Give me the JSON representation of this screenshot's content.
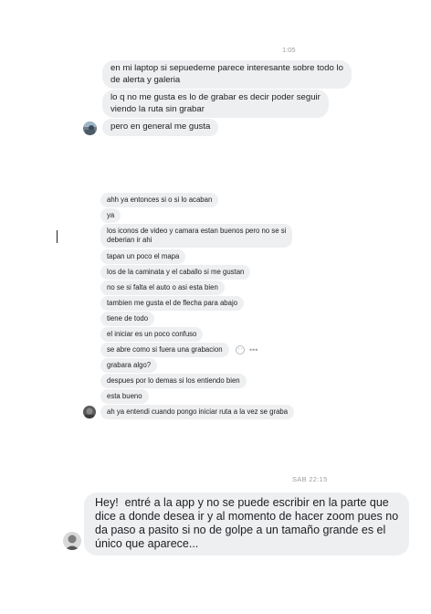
{
  "timestamps": {
    "first": "1:05",
    "last": "SAB 22:15"
  },
  "group1": [
    "en mi laptop si sepuedeme parece interesante sobre todo lo\nde alerta y galeria",
    "lo q no me gusta es lo de grabar es decir poder seguir\nviendo la ruta sin grabar",
    "pero en general me gusta"
  ],
  "group2": [
    "ahh ya  entonces si o si lo acaban",
    "ya",
    "los iconos de video y camara estan buenos pero no se si\ndeberian ir ahi",
    "tapan un poco el mapa",
    "los de la caminata y el caballo si me gustan",
    "no se si falta el auto o asi esta bien",
    "tambien me gusta el de flecha para abajo",
    "tiene de todo",
    "el iniciar es un poco confuso",
    "se abre como si fuera una grabacion",
    "grabara algo?",
    "despues por lo demas si los entiendo bien",
    "esta bueno",
    "ah ya entendi cuando pongo iniciar ruta a la vez se graba"
  ],
  "group3": [
    "Hey!  entré a la app y no se puede escribir en la parte que\ndice a donde desea ir y al momento de hacer zoom pues no\nda paso a pasito si no de golpe a un tamaño grande es el\núnico que aparece..."
  ],
  "icons": {
    "react": "smiley-react-icon",
    "more": "more-options-icon"
  }
}
